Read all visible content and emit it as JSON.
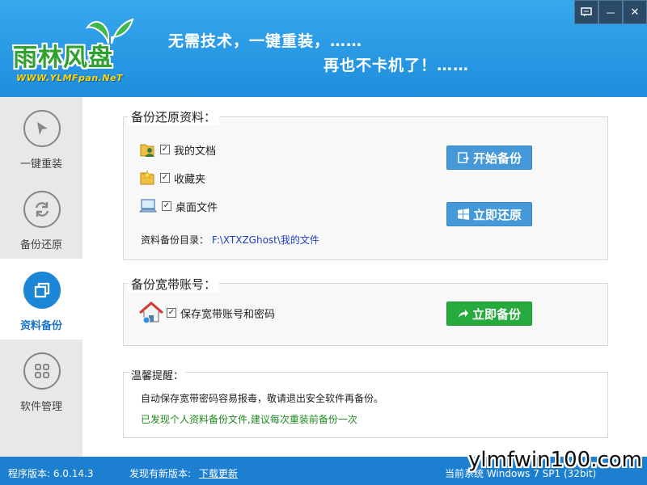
{
  "header": {
    "logo_text": "雨林风盘",
    "logo_url": "WWW.YLMFpan.NeT",
    "slogan_line1": "无需技术，一键重装，……",
    "slogan_line2": "再也不卡机了！……"
  },
  "window_controls": {
    "feedback_icon": "feedback-icon",
    "minimize": "－",
    "close": "✕"
  },
  "sidebar": {
    "items": [
      {
        "label": "一键重装",
        "icon": "cursor-arrow-icon"
      },
      {
        "label": "备份还原",
        "icon": "refresh-icon"
      },
      {
        "label": "资料备份",
        "icon": "copy-icon",
        "active": true
      },
      {
        "label": "软件管理",
        "icon": "grid-icon"
      }
    ]
  },
  "backup_restore": {
    "title": "备份还原资料：",
    "items": [
      {
        "label": "我的文档",
        "checked": true,
        "icon": "user-folder-icon"
      },
      {
        "label": "收藏夹",
        "checked": true,
        "icon": "favorites-folder-icon"
      },
      {
        "label": "桌面文件",
        "checked": true,
        "icon": "desktop-icon"
      }
    ],
    "start_backup_label": "开始备份",
    "restore_label": "立即还原",
    "dir_label": "资料备份目录：",
    "dir_value": "F:\\XTXZGhost\\我的文件"
  },
  "broadband": {
    "title": "备份宽带账号：",
    "item_label": "保存宽带账号和密码",
    "checked": true,
    "backup_now_label": "立即备份"
  },
  "tips": {
    "title": "温馨提醒：",
    "line1": "自动保存宽带密码容易报毒，敬请退出安全软件再备份。",
    "line2": "已发现个人资料备份文件,建议每次重装前备份一次"
  },
  "statusbar": {
    "version": "程序版本: 6.0.14.3",
    "new_version_label": "发现有新版本:",
    "download_link": "下载更新",
    "system_label": "当前系统 Windows 7 SP1 (32bit)"
  },
  "watermark": "ylmfwin100.com",
  "colors": {
    "header_blue": "#2596e4",
    "accent_blue": "#1b86d8",
    "button_blue": "#4699d9",
    "button_green": "#27ab3e",
    "tip_green": "#1d8a1d",
    "path_blue": "#2040c8"
  }
}
